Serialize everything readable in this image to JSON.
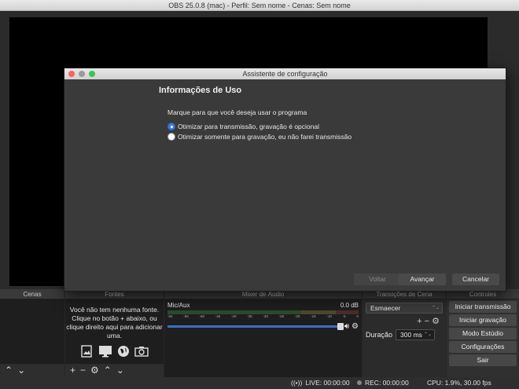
{
  "window": {
    "title": "OBS 25.0.8 (mac) - Perfil: Sem nome - Cenas: Sem nome"
  },
  "docks": {
    "scenes": {
      "title": "Cenas"
    },
    "sources": {
      "title": "Fontes",
      "empty_message": "Você não tem nenhuma fonte. Clique no botão + abaixo, ou clique direito aqui para adicionar uma."
    },
    "mixer": {
      "title": "Mixer de Áudio",
      "channel": "Mic/Aux",
      "level": "0.0 dB",
      "ticks": [
        "-60",
        "-55",
        "-50",
        "-45",
        "-40",
        "-35",
        "-30",
        "-25",
        "-20",
        "-15",
        "-10",
        "-5",
        "0"
      ]
    },
    "transitions": {
      "title": "Transições de Cena",
      "selected": "Esmaecer",
      "duration_label": "Duração",
      "duration_value": "300 ms"
    },
    "controls": {
      "title": "Controles",
      "buttons": [
        "Iniciar transmissão",
        "Iniciar gravação",
        "Modo Estúdio",
        "Configurações",
        "Sair"
      ]
    }
  },
  "status": {
    "live": "LIVE: 00:00:00",
    "rec": "REC: 00:00:00",
    "cpu": "CPU: 1.9%, 30.00 fps"
  },
  "dialog": {
    "title": "Assistente de configuração",
    "heading": "Informações de Uso",
    "question": "Marque para que você deseja usar o programa",
    "options": [
      "Otimizar para transmissão, gravação é opcional",
      "Otimizar somente para gravação, eu não farei transmissão"
    ],
    "selected_option": 0,
    "buttons": {
      "back": "Voltar",
      "next": "Avançar",
      "cancel": "Cancelar"
    }
  },
  "colors": {
    "accent": "#3b7be0",
    "dialog_bg": "#3a3a3a",
    "preview": "#000000"
  }
}
